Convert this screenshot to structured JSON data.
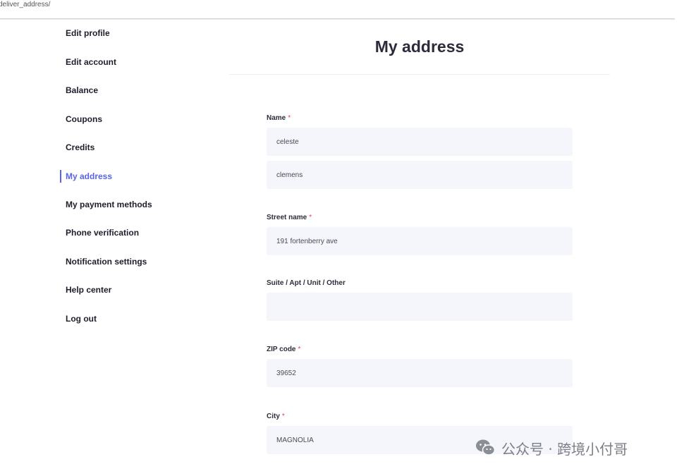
{
  "url_bar": {
    "text": "deliver_address/"
  },
  "sidebar": {
    "items": [
      {
        "label": "Edit profile"
      },
      {
        "label": "Edit account"
      },
      {
        "label": "Balance"
      },
      {
        "label": "Coupons"
      },
      {
        "label": "Credits"
      },
      {
        "label": "My address",
        "active": true
      },
      {
        "label": "My payment methods"
      },
      {
        "label": "Phone verification"
      },
      {
        "label": "Notification settings"
      },
      {
        "label": "Help center"
      },
      {
        "label": "Log out"
      }
    ]
  },
  "main": {
    "title": "My address",
    "fields": {
      "name_label": "Name",
      "first_name": "celeste",
      "last_name": "clemens",
      "street_label": "Street name",
      "street": "191 fortenberry ave",
      "suite_label": "Suite / Apt / Unit / Other",
      "suite": "",
      "zip_label": "ZIP code",
      "zip": "39652",
      "city_label": "City",
      "city": "MAGNOLIA"
    },
    "required_mark": "*"
  },
  "watermark": {
    "text": "公众号 · 跨境小付哥",
    "icon": "wechat-icon"
  },
  "colors": {
    "accent": "#5b63e6",
    "required": "#e0435a",
    "input_bg": "#f5f5fc"
  }
}
